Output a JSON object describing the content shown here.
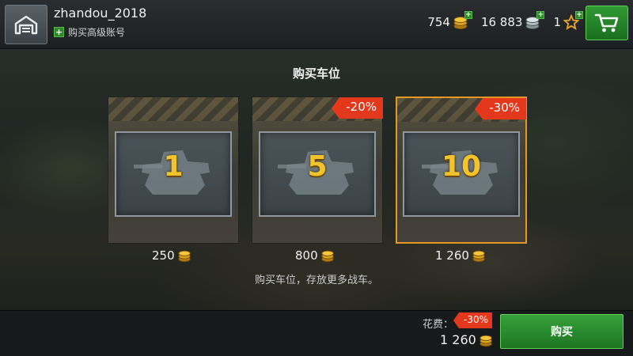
{
  "header": {
    "username": "zhandou_2018",
    "premium_label": "购买高级账号",
    "gold": "754",
    "silver": "16 883",
    "free_xp": "1"
  },
  "dialog": {
    "title": "购买车位",
    "description": "购买车位，存放更多战车。",
    "cards": [
      {
        "count": "1",
        "discount": "",
        "price": "250"
      },
      {
        "count": "5",
        "discount": "-20%",
        "price": "800"
      },
      {
        "count": "10",
        "discount": "-30%",
        "price": "1 260"
      }
    ]
  },
  "footer": {
    "cost_label": "花费：",
    "cost_discount": "-30%",
    "cost_amount": "1 260",
    "buy_label": "购买"
  },
  "icons": {
    "hangar": "hangar-icon",
    "cart": "cart-icon",
    "gold": "gold-coin-icon",
    "silver": "silver-coin-icon",
    "star": "star-icon"
  },
  "colors": {
    "accent_green": "#2f9a32",
    "discount_red": "#e4381d",
    "selected_orange": "#e49a22",
    "gold_text": "#f2c32a"
  }
}
